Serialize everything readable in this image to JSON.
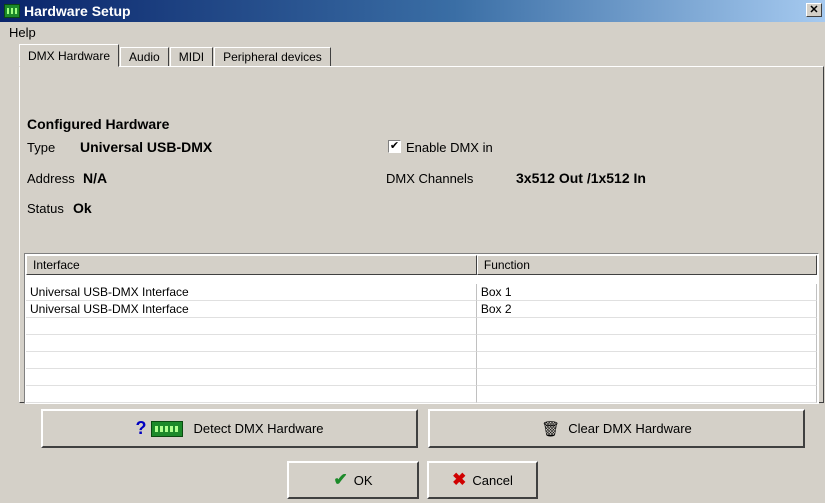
{
  "window": {
    "title": "Hardware Setup",
    "close_glyph": "✕"
  },
  "menu": {
    "help": "Help"
  },
  "tabs": [
    {
      "label": "DMX Hardware",
      "active": true
    },
    {
      "label": "Audio"
    },
    {
      "label": "MIDI"
    },
    {
      "label": "Peripheral devices"
    }
  ],
  "config": {
    "section_title": "Configured Hardware",
    "type_label": "Type",
    "type_value": "Universal USB-DMX",
    "address_label": "Address",
    "address_value": "N/A",
    "status_label": "Status",
    "status_value": "Ok",
    "enable_dmx_in_label": "Enable DMX in",
    "enable_dmx_in_checked": true,
    "dmx_channels_label": "DMX Channels",
    "dmx_channels_value": "3x512 Out /1x512 In"
  },
  "grid": {
    "columns": [
      "Interface",
      "Function"
    ],
    "rows": [
      [
        "Universal USB-DMX Interface",
        "Box 1"
      ],
      [
        "Universal USB-DMX Interface",
        "Box 2"
      ],
      [
        "",
        ""
      ],
      [
        "",
        ""
      ],
      [
        "",
        ""
      ],
      [
        "",
        ""
      ],
      [
        "",
        ""
      ]
    ]
  },
  "buttons": {
    "detect": "Detect DMX Hardware",
    "detect_help_glyph": "?",
    "clear": "Clear DMX Hardware",
    "clear_glyph": "🗑",
    "ok": "OK",
    "ok_glyph": "✔",
    "cancel": "Cancel",
    "cancel_glyph": "✖"
  },
  "icons": {
    "app": "dmx-card-icon",
    "detect": "dmx-card-icon",
    "help": "question-icon",
    "clear": "trash-icon",
    "ok": "checkmark-icon",
    "cancel": "x-icon"
  },
  "colors": {
    "title_start": "#0a246a",
    "title_end": "#a6caf0",
    "face": "#d4d0c8",
    "card_green": "#1c8a2a"
  }
}
